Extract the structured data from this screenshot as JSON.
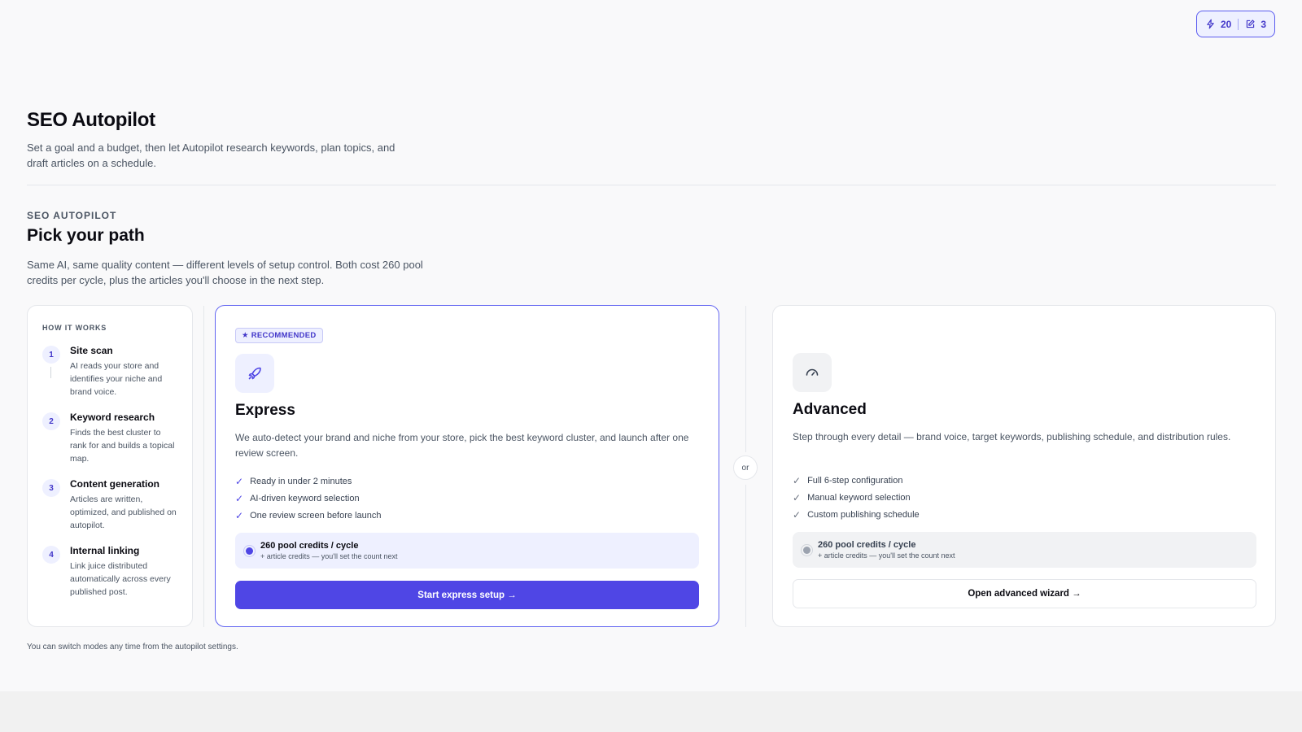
{
  "credits": {
    "lightning_count": "20",
    "article_count": "3"
  },
  "header": {
    "title": "SEO Autopilot",
    "subtitle": "Set a goal and a budget, then let Autopilot research keywords, plan topics, and draft articles on a schedule."
  },
  "section": {
    "eyebrow": "SEO AUTOPILOT",
    "title": "Pick your path",
    "description": "Same AI, same quality content — different levels of setup control. Both cost 260 pool credits per cycle, plus the articles you'll choose in the next step."
  },
  "how_it_works": {
    "heading": "HOW IT WORKS",
    "steps": [
      {
        "num": "1",
        "title": "Site scan",
        "desc": "AI reads your store and identifies your niche and brand voice."
      },
      {
        "num": "2",
        "title": "Keyword research",
        "desc": "Finds the best cluster to rank for and builds a topical map."
      },
      {
        "num": "3",
        "title": "Content generation",
        "desc": "Articles are written, optimized, and published on autopilot."
      },
      {
        "num": "4",
        "title": "Internal linking",
        "desc": "Link juice distributed automatically across every published post."
      }
    ]
  },
  "express": {
    "badge": "★ RECOMMENDED",
    "icon": "rocket-icon",
    "title": "Express",
    "description": "We auto-detect your brand and niche from your store, pick the best keyword cluster, and launch after one review screen.",
    "features": [
      "Ready in under 2 minutes",
      "AI-driven keyword selection",
      "One review screen before launch"
    ],
    "cost_main": "260 pool credits / cycle",
    "cost_sub": "+ article credits — you'll set the count next",
    "button_label": "Start express setup →"
  },
  "divider_label": "or",
  "advanced": {
    "icon": "gauge-icon",
    "title": "Advanced",
    "description": "Step through every detail — brand voice, target keywords, publishing schedule, and distribution rules.",
    "features": [
      "Full 6-step configuration",
      "Manual keyword selection",
      "Custom publishing schedule"
    ],
    "cost_main": "260 pool credits / cycle",
    "cost_sub": "+ article credits — you'll set the count next",
    "button_label": "Open advanced wizard →"
  },
  "footnote": "You can switch modes any time from the autopilot settings.",
  "colors": {
    "accent": "#4f46e5",
    "accent_soft": "#eef0ff",
    "text": "#0b0b12",
    "muted": "#4b5563"
  }
}
